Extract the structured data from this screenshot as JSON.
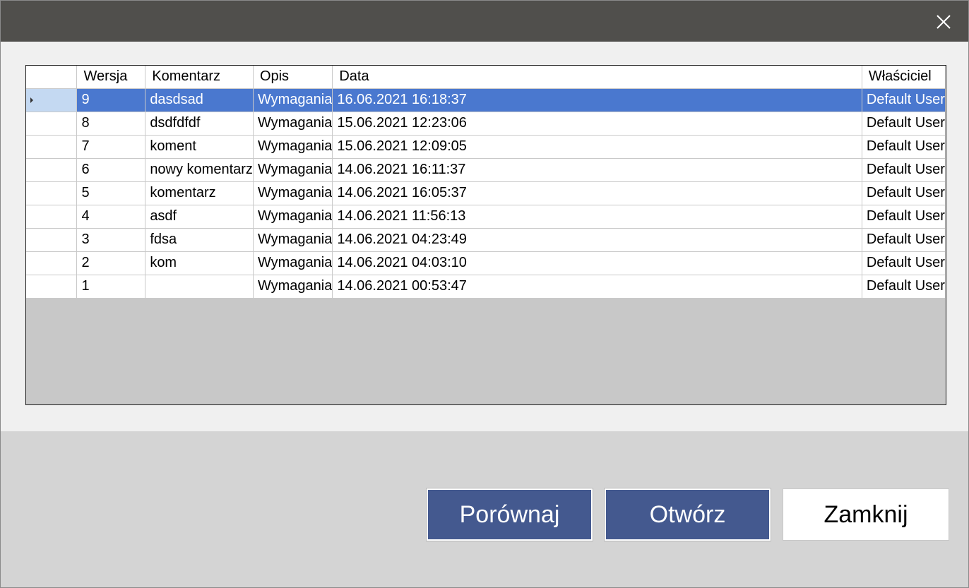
{
  "titlebar": {
    "close_icon": "close-icon"
  },
  "grid": {
    "columns": [
      "",
      "Wersja",
      "Komentarz",
      "Opis",
      "Data",
      "Właściciel"
    ],
    "rows": [
      [
        "9",
        "dasdsad",
        "Wymagania",
        "16.06.2021 16:18:37",
        "Default User"
      ],
      [
        "8",
        "dsdfdfdf",
        "Wymagania",
        "15.06.2021 12:23:06",
        "Default User"
      ],
      [
        "7",
        "koment",
        "Wymagania",
        "15.06.2021 12:09:05",
        "Default User"
      ],
      [
        "6",
        "nowy komentarz",
        "Wymagania",
        "14.06.2021 16:11:37",
        "Default User"
      ],
      [
        "5",
        "komentarz",
        "Wymagania",
        "14.06.2021 16:05:37",
        "Default User"
      ],
      [
        "4",
        "asdf",
        "Wymagania",
        "14.06.2021 11:56:13",
        "Default User"
      ],
      [
        "3",
        "fdsa",
        "Wymagania",
        "14.06.2021 04:23:49",
        "Default User"
      ],
      [
        "2",
        "kom",
        "Wymagania",
        "14.06.2021 04:03:10",
        "Default User"
      ],
      [
        "1",
        "",
        "Wymagania",
        "14.06.2021 00:53:47",
        "Default User"
      ]
    ],
    "selected_row": 0
  },
  "buttons": {
    "compare_label": "Porównaj",
    "open_label": "Otwórz",
    "close_label": "Zamknij"
  },
  "colors": {
    "titlebar": "#504f4c",
    "selection": "#4a78cf",
    "primary_button": "#44598f"
  }
}
